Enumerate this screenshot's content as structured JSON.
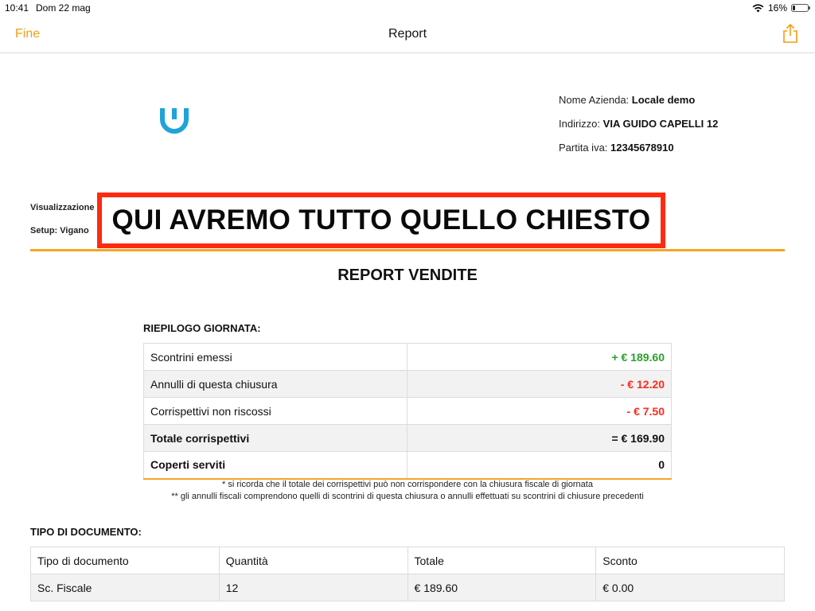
{
  "status_bar": {
    "time": "10:41",
    "date": "Dom 22 mag",
    "battery": "16%",
    "battery_level": 0.16
  },
  "nav": {
    "done_label": "Fine",
    "title": "Report"
  },
  "company": {
    "name_label": "Nome Azienda:",
    "name_value": "Locale demo",
    "address_label": "Indirizzo:",
    "address_value": "VIA GUIDO CAPELLI 12",
    "vat_label": "Partita iva:",
    "vat_value": "12345678910"
  },
  "meta": {
    "visualizzazione": "Visualizzazione",
    "setup": "Setup: Vigano"
  },
  "highlight_text": "QUI AVREMO TUTTO QUELLO CHIESTO",
  "report_title": "REPORT VENDITE",
  "summary": {
    "label": "RIEPILOGO GIORNATA:",
    "rows": [
      {
        "label": "Scontrini emessi",
        "value": "+ € 189.60"
      },
      {
        "label": "Annulli di questa chiusura",
        "value": "- € 12.20"
      },
      {
        "label": "Corrispettivi non riscossi",
        "value": "- € 7.50"
      },
      {
        "label": "Totale corrispettivi",
        "value": "= € 169.90"
      },
      {
        "label": "Coperti serviti",
        "value": "0"
      }
    ],
    "note1": "* si ricorda che il totale dei corrispettivi può non corrispondere con la chiusura fiscale di giornata",
    "note2": "** gli annulli fiscali comprendono quelli di scontrini di questa chiusura o annulli effettuati su scontrini di chiusure precedenti"
  },
  "documents": {
    "label": "TIPO DI DOCUMENTO:",
    "headers": [
      "Tipo di documento",
      "Quantità",
      "Totale",
      "Sconto"
    ],
    "rows": [
      [
        "Sc. Fiscale",
        "12",
        "€ 189.60",
        "€ 0.00"
      ]
    ]
  },
  "colors": {
    "accent": "#f5a623",
    "link": "#f39c12",
    "positive": "#2aa02a",
    "negative": "#ff2a1a",
    "highlight_border": "#ff2a0f",
    "logo": "#1fa3d8"
  },
  "icons": {
    "share": "share-icon",
    "wifi": "wifi-icon",
    "battery": "battery-icon",
    "logo": "brand-logo"
  }
}
